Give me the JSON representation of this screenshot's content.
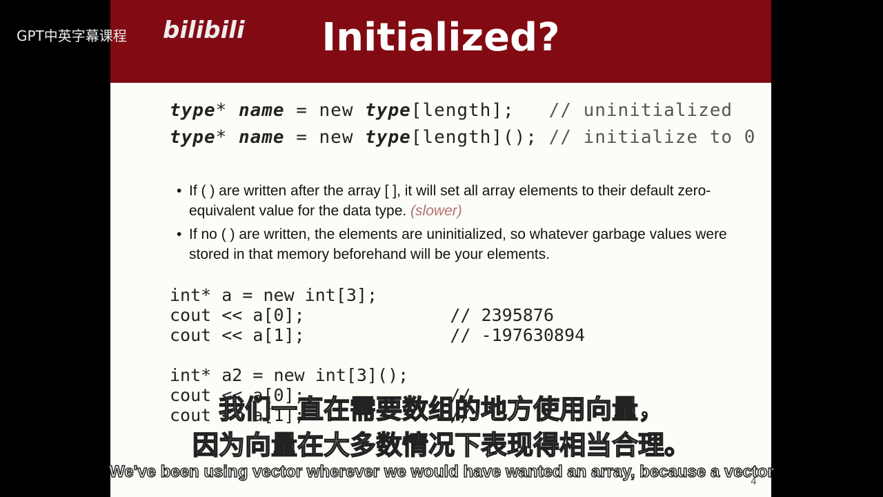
{
  "watermark": {
    "text": "GPT中英字幕课程",
    "logo": "bilibili"
  },
  "slide": {
    "title": "Initialized?",
    "syntax": [
      {
        "type1": "type",
        "mid": "* ",
        "name": "name",
        "eq": " = new ",
        "type2": "type",
        "br": "[length]",
        "tail": ";   ",
        "comment": "// uninitialized"
      },
      {
        "type1": "type",
        "mid": "* ",
        "name": "name",
        "eq": " = new ",
        "type2": "type",
        "br": "[length]",
        "tail": "(); ",
        "comment": "// initialize to 0"
      }
    ],
    "bullets": [
      {
        "text": "If ( ) are written after the array [ ], it will set all array elements to their default zero-equivalent value for the data type.",
        "note": "(slower)"
      },
      {
        "text": "If no ( ) are written, the elements are uninitialized, so whatever garbage values were stored in that memory beforehand will be your elements.",
        "note": ""
      }
    ],
    "code1": [
      "int* a = new int[3];",
      "cout << a[0];              // 2395876",
      "cout << a[1];              // -197630894"
    ],
    "code2": [
      "int* a2 = new int[3]();",
      "cout << a[0];              //",
      "cout << a[1];              //"
    ],
    "page_number": "4"
  },
  "subtitles": {
    "zh_line1": "我们一直在需要数组的地方使用向量，",
    "zh_line2": "因为向量在大多数情况下表现得相当合理。",
    "en": "We've been using vector wherever we would have wanted an array, because a vector"
  }
}
